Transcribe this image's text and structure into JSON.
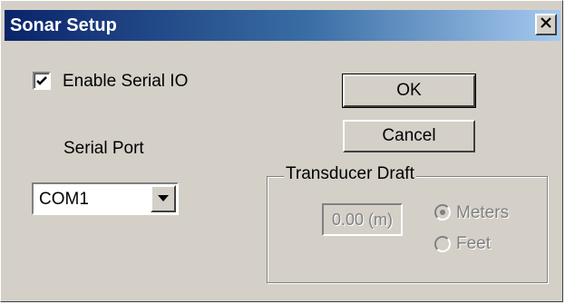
{
  "window": {
    "title": "Sonar Setup",
    "close_icon": "close-icon"
  },
  "serial": {
    "enable_label": "Enable Serial IO",
    "enabled": true,
    "port_label": "Serial Port",
    "port_value": "COM1"
  },
  "buttons": {
    "ok_label": "OK",
    "cancel_label": "Cancel"
  },
  "transducer": {
    "group_label": "Transducer Draft",
    "draft_value": "0.00 (m)",
    "units": [
      {
        "label": "Meters",
        "selected": true
      },
      {
        "label": "Feet",
        "selected": false
      }
    ],
    "enabled": false
  },
  "colors": {
    "face": "#d4d0c8",
    "title_start": "#0a246a",
    "title_end": "#a6caf0",
    "disabled_text": "#808080"
  }
}
